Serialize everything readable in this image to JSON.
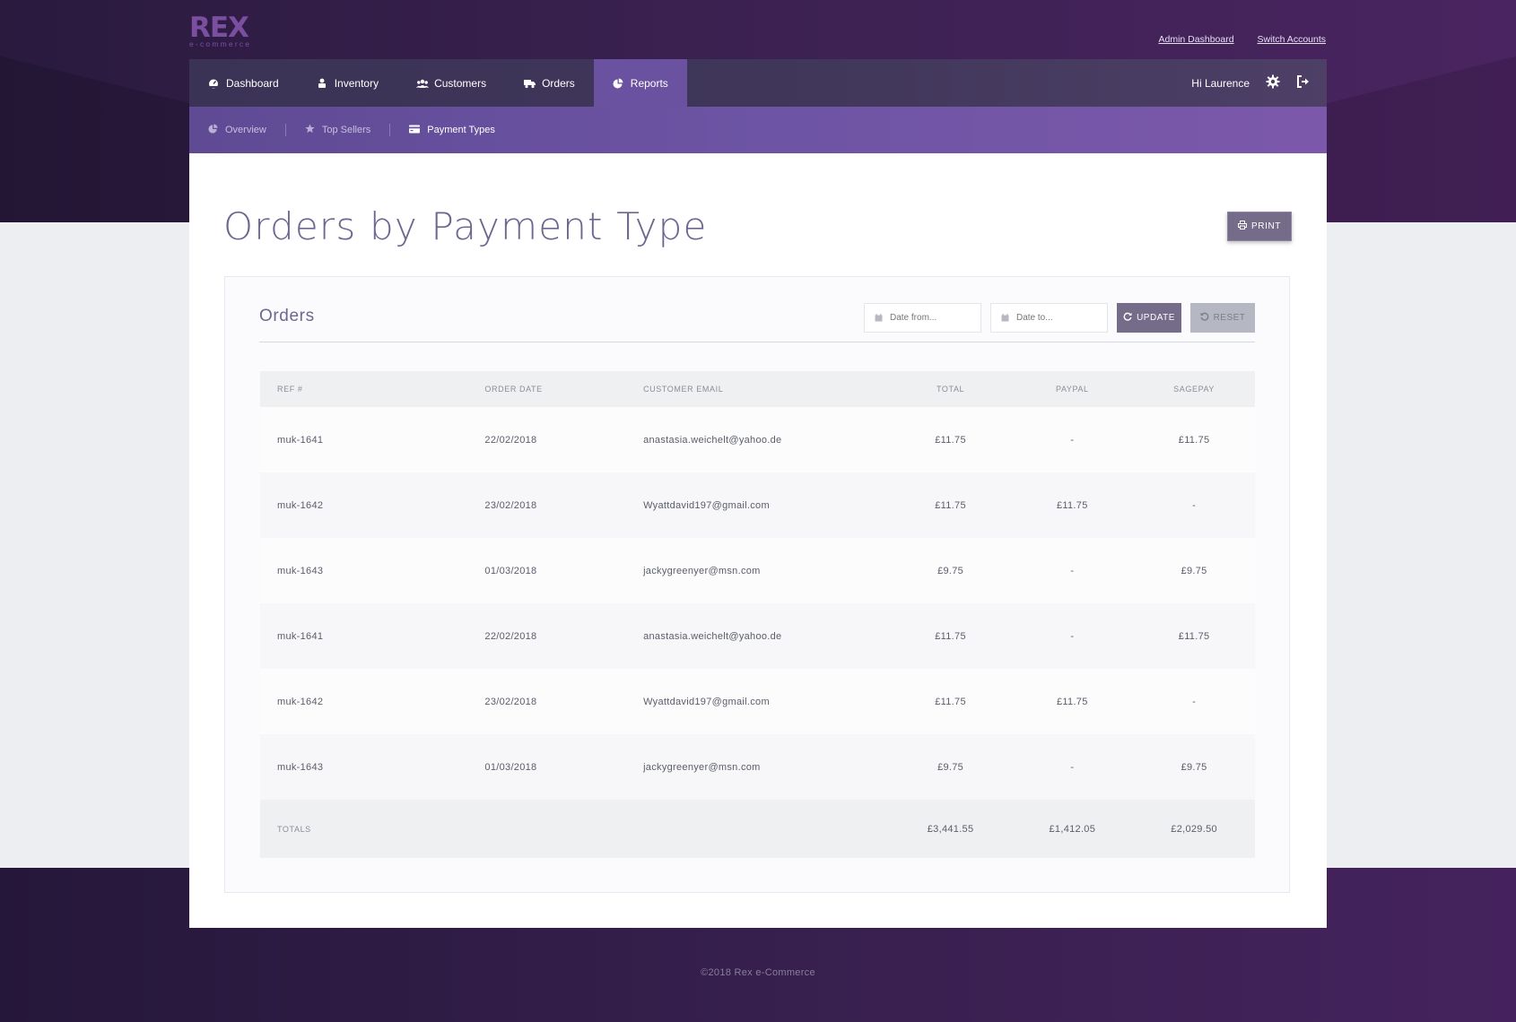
{
  "brand": {
    "logo_text": "REX",
    "logo_sub": "e-commerce"
  },
  "top_links": {
    "admin": "Admin Dashboard",
    "switch": "Switch Accounts"
  },
  "nav": {
    "items": [
      {
        "label": "Dashboard",
        "icon": "dashboard-icon"
      },
      {
        "label": "Inventory",
        "icon": "inventory-icon"
      },
      {
        "label": "Customers",
        "icon": "customers-icon"
      },
      {
        "label": "Orders",
        "icon": "truck-icon"
      },
      {
        "label": "Reports",
        "icon": "pie-chart-icon",
        "active": true
      }
    ],
    "greeting": "Hi Laurence"
  },
  "subnav": {
    "items": [
      {
        "label": "Overview",
        "icon": "pie-chart-icon"
      },
      {
        "label": "Top Sellers",
        "icon": "star-icon"
      },
      {
        "label": "Payment Types",
        "icon": "credit-card-icon",
        "active": true
      }
    ]
  },
  "page": {
    "title": "Orders by Payment Type",
    "print_label": "PRINT"
  },
  "card": {
    "title": "Orders",
    "date_from_placeholder": "Date from...",
    "date_to_placeholder": "Date to...",
    "update_label": "UPDATE",
    "reset_label": "RESET"
  },
  "table": {
    "headers": [
      "REF #",
      "ORDER DATE",
      "CUSTOMER EMAIL",
      "TOTAL",
      "PAYPAL",
      "SAGEPAY"
    ],
    "rows": [
      {
        "ref": "muk-1641",
        "date": "22/02/2018",
        "email": "anastasia.weichelt@yahoo.de",
        "total": "£11.75",
        "paypal": "-",
        "sagepay": "£11.75"
      },
      {
        "ref": "muk-1642",
        "date": "23/02/2018",
        "email": "Wyattdavid197@gmail.com",
        "total": "£11.75",
        "paypal": "£11.75",
        "sagepay": "-"
      },
      {
        "ref": "muk-1643",
        "date": "01/03/2018",
        "email": "jackygreenyer@msn.com",
        "total": "£9.75",
        "paypal": "-",
        "sagepay": "£9.75"
      },
      {
        "ref": "muk-1641",
        "date": "22/02/2018",
        "email": "anastasia.weichelt@yahoo.de",
        "total": "£11.75",
        "paypal": "-",
        "sagepay": "£11.75"
      },
      {
        "ref": "muk-1642",
        "date": "23/02/2018",
        "email": "Wyattdavid197@gmail.com",
        "total": "£11.75",
        "paypal": "£11.75",
        "sagepay": "-"
      },
      {
        "ref": "muk-1643",
        "date": "01/03/2018",
        "email": "jackygreenyer@msn.com",
        "total": "£9.75",
        "paypal": "-",
        "sagepay": "£9.75"
      }
    ],
    "totals": {
      "label": "TOTALS",
      "total": "£3,441.55",
      "paypal": "£1,412.05",
      "sagepay": "£2,029.50"
    }
  },
  "footer": "©2018 Rex e-Commerce",
  "colors": {
    "accent": "#6a52a0",
    "nav": "#3f3659",
    "button": "#756c89"
  }
}
